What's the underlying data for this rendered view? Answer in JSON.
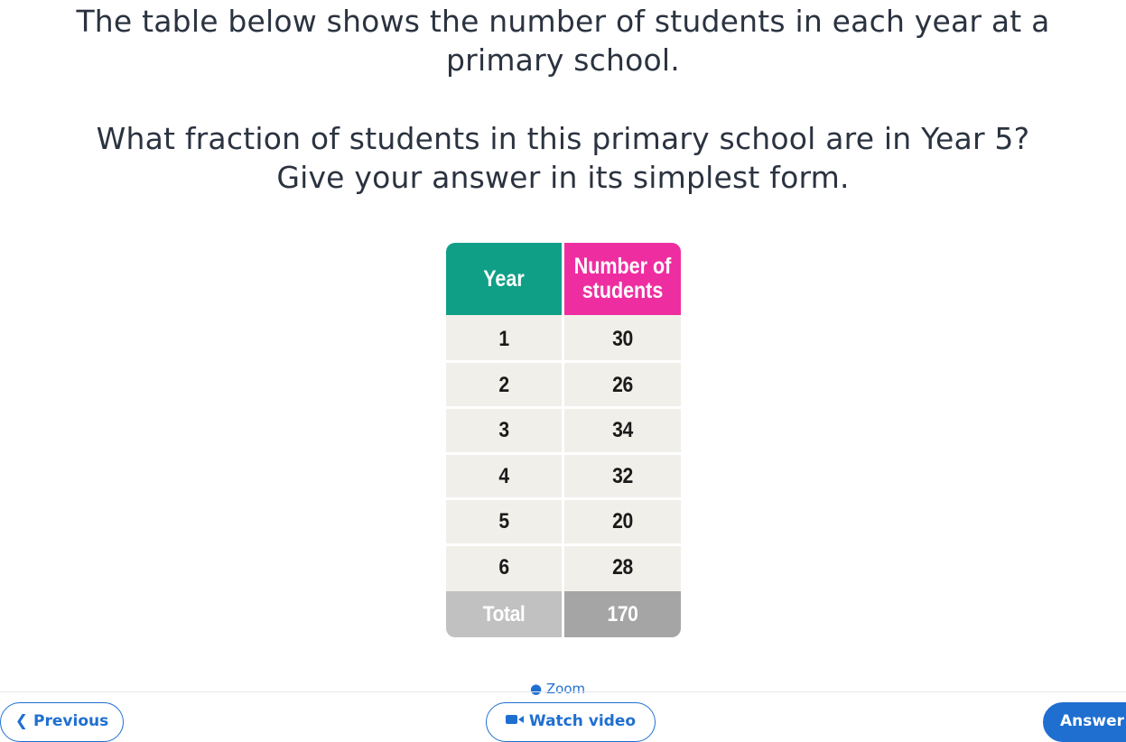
{
  "question": {
    "line1": "The table below shows the number of students in each year at a",
    "line2": "primary school.",
    "line3": "What fraction of students in this primary school are in Year 5?",
    "line4": "Give your answer in its simplest form."
  },
  "table": {
    "header_year": "Year",
    "header_students_line1": "Number of",
    "header_students_line2": "students",
    "rows": [
      {
        "year": "1",
        "students": "30"
      },
      {
        "year": "2",
        "students": "26"
      },
      {
        "year": "3",
        "students": "34"
      },
      {
        "year": "4",
        "students": "32"
      },
      {
        "year": "5",
        "students": "20"
      },
      {
        "year": "6",
        "students": "28"
      }
    ],
    "total_label": "Total",
    "total_value": "170",
    "colors": {
      "year_header": "#0f9f87",
      "students_header": "#ee2ea0",
      "body": "#f1efe9",
      "total_year": "#c1c1c1",
      "total_value": "#a5a5a5"
    }
  },
  "zoom": {
    "label": "Zoom",
    "icon": "zoom-icon"
  },
  "footer": {
    "previous_label": "Previous",
    "previous_icon": "chevron-left-icon",
    "watch_video_label": "Watch video",
    "watch_video_icon": "video-camera-icon",
    "answer_label": "Answer",
    "accent": "#1f6fd1"
  }
}
